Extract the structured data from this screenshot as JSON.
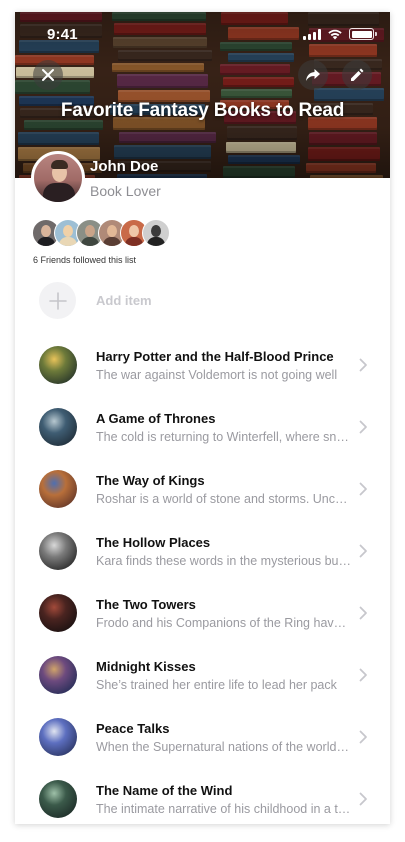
{
  "status_bar": {
    "time": "9:41"
  },
  "header": {
    "title": "Favorite Fantasy Books to Read",
    "close_icon": "close-icon",
    "share_icon": "share-icon",
    "edit_icon": "pencil-icon"
  },
  "profile": {
    "name": "John Doe",
    "role": "Book Lover"
  },
  "friends": {
    "count": 6,
    "caption": "6 Friends followed this list"
  },
  "add_item": {
    "label": "Add item"
  },
  "books": [
    {
      "title": "Harry Potter and the Half-Blood Prince",
      "description": "The war against Voldemort is not going well"
    },
    {
      "title": "A Game of Thrones",
      "description": "The cold is returning to Winterfell, where snow"
    },
    {
      "title": "The Way of Kings",
      "description": "Roshar is a world of stone and storms. Uncanny"
    },
    {
      "title": "The Hollow Places",
      "description": "Kara finds these words in the mysterious bunker"
    },
    {
      "title": "The Two Towers",
      "description": "Frodo and his Companions of the Ring have been"
    },
    {
      "title": "Midnight Kisses",
      "description": "She’s trained her entire life to lead her pack"
    },
    {
      "title": "Peace Talks",
      "description": "When the Supernatural nations of the world meet"
    },
    {
      "title": "The Name of the Wind",
      "description": "The intimate narrative of his childhood in a troupe"
    }
  ],
  "colors": {
    "muted_text": "#9a9aa0",
    "add_label": "#c9c9ce",
    "chevron": "#c7c7cc"
  }
}
